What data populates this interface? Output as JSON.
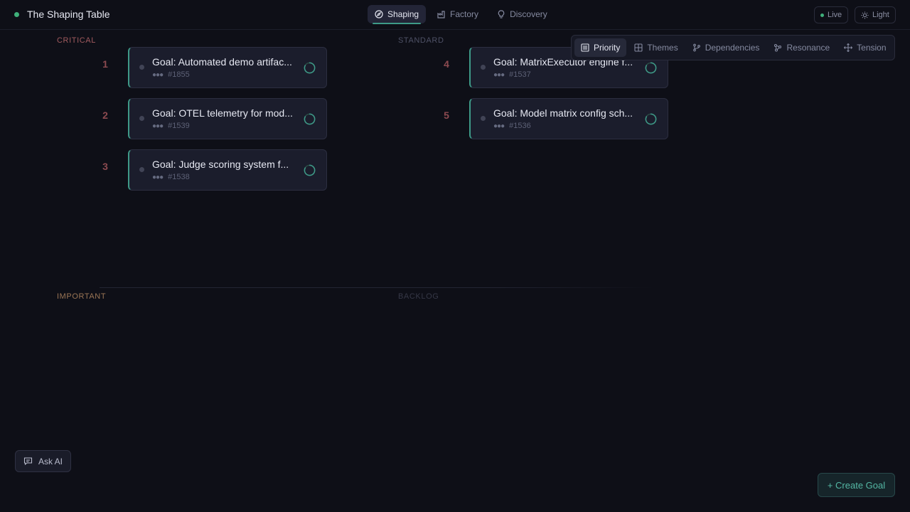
{
  "app": {
    "title": "The Shaping Table",
    "accent": "#3e9a88",
    "status_color": "#3fb07a"
  },
  "nav": {
    "tabs": [
      {
        "label": "Shaping",
        "icon": "compass-icon",
        "active": true
      },
      {
        "label": "Factory",
        "icon": "factory-icon",
        "active": false
      },
      {
        "label": "Discovery",
        "icon": "lightbulb-icon",
        "active": false
      }
    ]
  },
  "header": {
    "live_label": "Live",
    "theme_label": "Light"
  },
  "views": {
    "tabs": [
      {
        "label": "Priority",
        "icon": "list-icon",
        "active": true
      },
      {
        "label": "Themes",
        "icon": "grid-icon",
        "active": false
      },
      {
        "label": "Dependencies",
        "icon": "branch-icon",
        "active": false
      },
      {
        "label": "Resonance",
        "icon": "network-icon",
        "active": false
      },
      {
        "label": "Tension",
        "icon": "move-icon",
        "active": false
      }
    ]
  },
  "quadrants": {
    "critical": "CRITICAL",
    "standard": "STANDARD",
    "important": "IMPORTANT",
    "backlog": "BACKLOG"
  },
  "goals": [
    {
      "rank": "1",
      "title": "Goal: Automated demo artifac...",
      "id": "#1855"
    },
    {
      "rank": "2",
      "title": "Goal: OTEL telemetry for mod...",
      "id": "#1539"
    },
    {
      "rank": "3",
      "title": "Goal: Judge scoring system f...",
      "id": "#1538"
    },
    {
      "rank": "4",
      "title": "Goal: MatrixExecutor engine f...",
      "id": "#1537"
    },
    {
      "rank": "5",
      "title": "Goal: Model matrix config sch...",
      "id": "#1536"
    }
  ],
  "actions": {
    "ask_ai": "Ask AI",
    "create_goal": "+ Create Goal"
  }
}
